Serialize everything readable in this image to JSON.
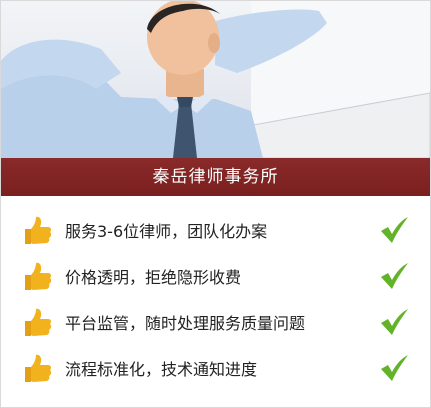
{
  "banner": {
    "title": "秦岳律师事务所"
  },
  "features": [
    {
      "text": "服务3-6位律师，团队化办案"
    },
    {
      "text": "价格透明，拒绝隐形收费"
    },
    {
      "text": "平台监管，随时处理服务质量问题"
    },
    {
      "text": "流程标准化，技术通知进度"
    }
  ],
  "colors": {
    "banner": "#7f2424",
    "thumb": "#f2b21e",
    "check": "#62b32a"
  }
}
